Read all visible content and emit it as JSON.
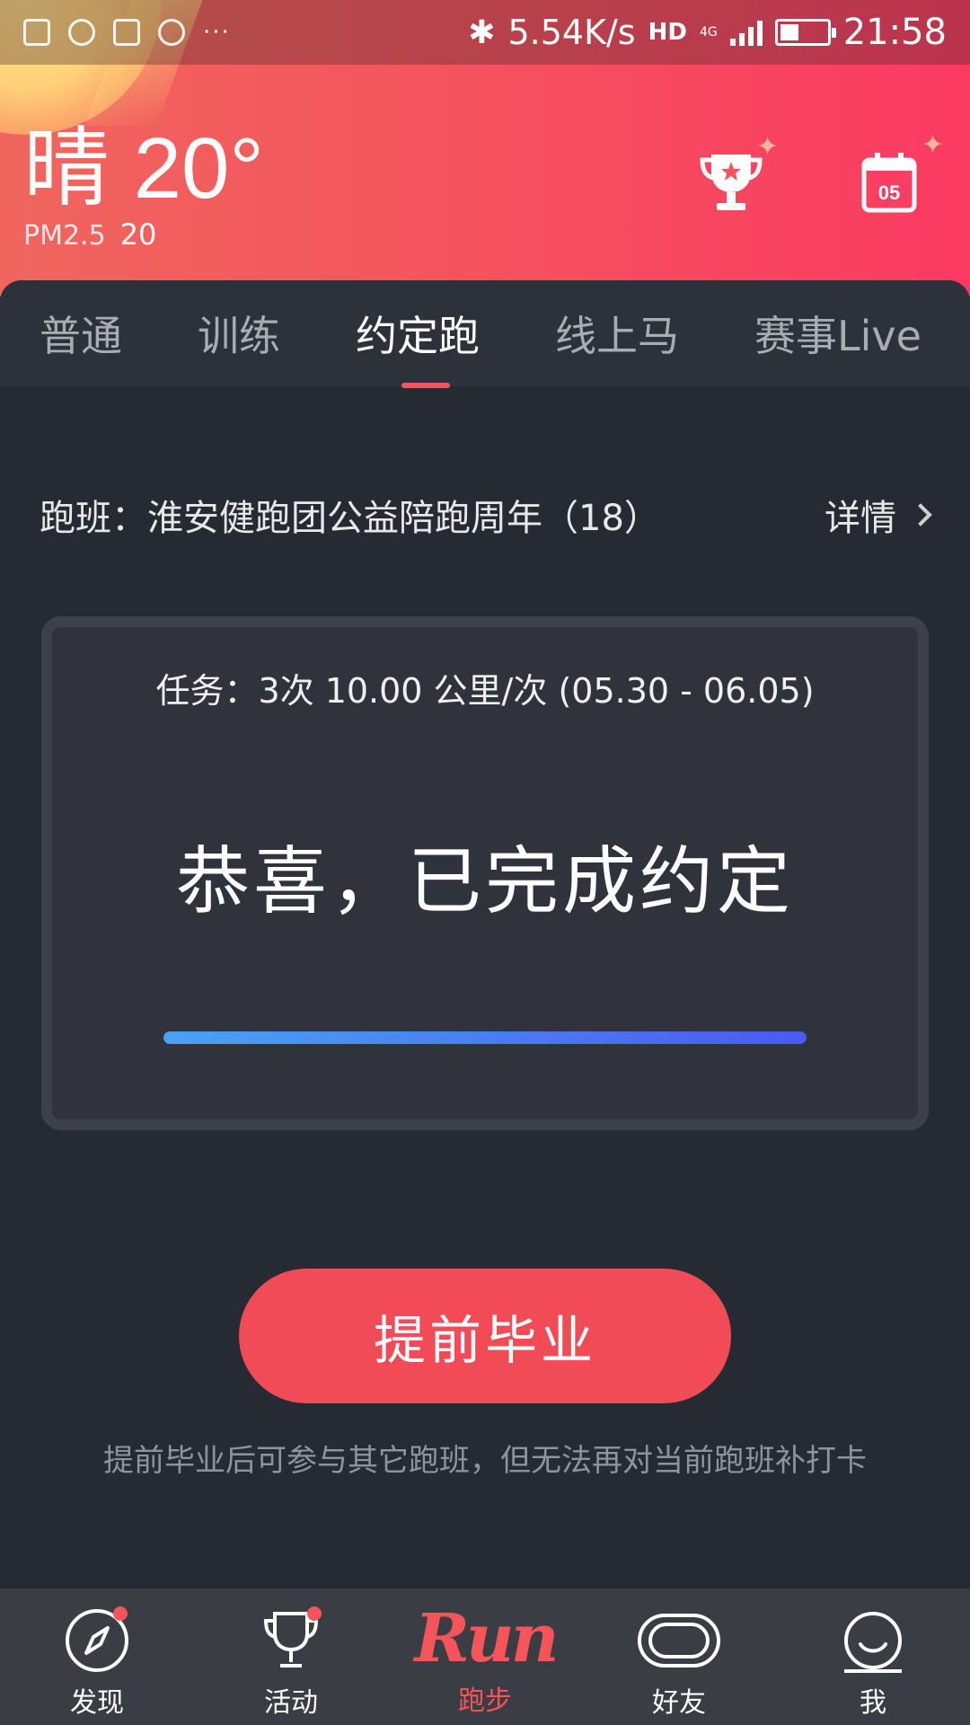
{
  "status_bar": {
    "net_speed": "5.54K/s",
    "hd": "HD",
    "network": "4G",
    "clock": "21:58",
    "dots": "···"
  },
  "weather": {
    "condition_temp": "晴 20°",
    "pm_label": "PM2.5",
    "pm_value": "20"
  },
  "tabs": [
    {
      "label": "普通",
      "active": false
    },
    {
      "label": "训练",
      "active": false
    },
    {
      "label": "约定跑",
      "active": true
    },
    {
      "label": "线上马",
      "active": false
    },
    {
      "label": "赛事Live",
      "active": false
    }
  ],
  "club": {
    "name": "跑班：淮安健跑团公益陪跑周年（18）",
    "details_label": "详情"
  },
  "task": {
    "line": "任务：3次 10.00 公里/次 (05.30 - 06.05)",
    "congrats": "恭喜，已完成约定",
    "progress": 1.0
  },
  "calendar_day": "05",
  "graduate": {
    "button_label": "提前毕业",
    "note": "提前毕业后可参与其它跑班，但无法再对当前跑班补打卡"
  },
  "bottom_nav": [
    {
      "label": "发现",
      "icon": "compass-icon",
      "badge": true
    },
    {
      "label": "活动",
      "icon": "trophy-icon",
      "badge": true
    },
    {
      "label": "跑步",
      "icon": "run-logo",
      "badge": false,
      "logo_text": "Run"
    },
    {
      "label": "好友",
      "icon": "track-icon",
      "badge": false
    },
    {
      "label": "我",
      "icon": "smile-icon",
      "badge": false
    }
  ],
  "colors": {
    "accent": "#f5545b",
    "background": "#262a33",
    "progress_start": "#4aa2f2",
    "progress_end": "#4a5af0"
  }
}
